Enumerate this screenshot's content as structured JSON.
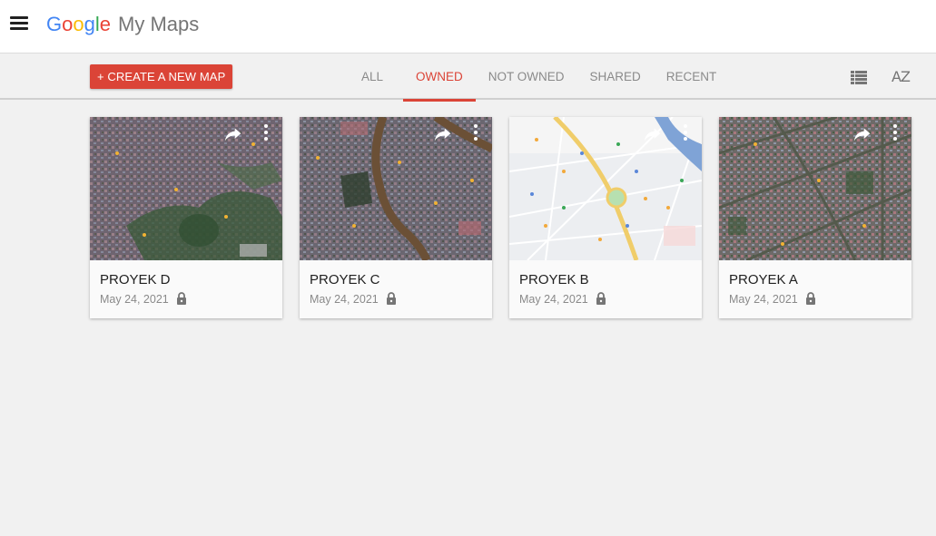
{
  "header": {
    "logo_letters": [
      "G",
      "o",
      "o",
      "g",
      "l",
      "e"
    ],
    "product_name": "My Maps",
    "menu_icon": "hamburger-menu-icon"
  },
  "toolbar": {
    "create_button_label": "+ CREATE A NEW MAP",
    "tabs": [
      {
        "label": "ALL",
        "active": false
      },
      {
        "label": "OWNED",
        "active": true
      },
      {
        "label": "NOT OWNED",
        "active": false
      },
      {
        "label": "SHARED",
        "active": false
      },
      {
        "label": "RECENT",
        "active": false
      }
    ],
    "view_toggle_icon": "list-view-icon",
    "sort_icon": "sort-az-icon",
    "sort_label": "AZ"
  },
  "colors": {
    "accent": "#db4437",
    "background": "#f1f1f1",
    "text_primary": "#212121",
    "text_secondary": "#8a8a8a"
  },
  "maps": [
    {
      "title": "PROYEK D",
      "date": "May 24, 2021",
      "thumbnail": "satellite",
      "private": true
    },
    {
      "title": "PROYEK C",
      "date": "May 24, 2021",
      "thumbnail": "satellite-river",
      "private": true
    },
    {
      "title": "PROYEK B",
      "date": "May 24, 2021",
      "thumbnail": "roadmap",
      "private": true
    },
    {
      "title": "PROYEK A",
      "date": "May 24, 2021",
      "thumbnail": "satellite-grid",
      "private": true
    }
  ]
}
